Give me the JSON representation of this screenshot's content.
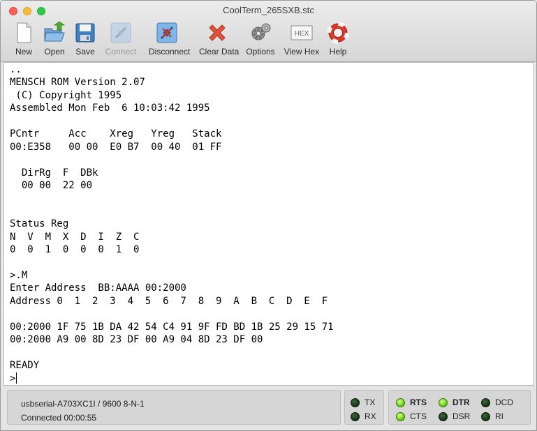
{
  "window": {
    "title": "CoolTerm_265SXB.stc"
  },
  "toolbar": {
    "buttons": [
      {
        "label": "New",
        "icon": "new-document-icon",
        "enabled": true
      },
      {
        "label": "Open",
        "icon": "open-folder-icon",
        "enabled": true
      },
      {
        "label": "Save",
        "icon": "floppy-disk-icon",
        "enabled": true
      },
      {
        "label": "Connect",
        "icon": "connect-plug-icon",
        "enabled": false
      },
      {
        "label": "Disconnect",
        "icon": "disconnect-plug-icon",
        "enabled": true
      },
      {
        "label": "Clear Data",
        "icon": "clear-x-icon",
        "enabled": true
      },
      {
        "label": "Options",
        "icon": "gears-icon",
        "enabled": true
      },
      {
        "label": "View Hex",
        "icon": "hex-icon",
        "enabled": true
      },
      {
        "label": "Help",
        "icon": "lifebuoy-icon",
        "enabled": true
      }
    ],
    "hex_icon_text": "HEX"
  },
  "terminal": {
    "lines": [
      "..",
      "MENSCH ROM Version 2.07",
      " (C) Copyright 1995",
      "Assembled Mon Feb  6 10:03:42 1995",
      "",
      "PCntr     Acc    Xreg   Yreg   Stack",
      "00:E358   00 00  E0 B7  00 40  01 FF",
      "",
      "  DirRg  F  DBk",
      "  00 00  22 00",
      "",
      "",
      "Status Reg",
      "N  V  M  X  D  I  Z  C",
      "0  0  1  0  0  0  1  0",
      "",
      ">.M",
      "Enter Address  BB:AAAA 00:2000",
      "Address 0  1  2  3  4  5  6  7  8  9  A  B  C  D  E  F",
      "",
      "00:2000 1F 75 1B DA 42 54 C4 91 9F FD BD 1B 25 29 15 71",
      "00:2000 A9 00 8D 23 DF 00 A9 04 8D 23 DF 00",
      "",
      "READY"
    ],
    "prompt": ">"
  },
  "status": {
    "port_settings": "usbserial-A703XC1I / 9600 8-N-1",
    "connection": "Connected 00:00:55",
    "leds": {
      "tx": {
        "label": "TX",
        "on": false
      },
      "rx": {
        "label": "RX",
        "on": false
      },
      "rts": {
        "label": "RTS",
        "on": true
      },
      "cts": {
        "label": "CTS",
        "on": true
      },
      "dtr": {
        "label": "DTR",
        "on": true
      },
      "dsr": {
        "label": "DSR",
        "on": false
      },
      "dcd": {
        "label": "DCD",
        "on": false
      },
      "ri": {
        "label": "RI",
        "on": false
      }
    }
  },
  "colors": {
    "led_on": "#6ccb1a",
    "led_off": "#1d3a1d",
    "terminal_bg": "#ffffff"
  }
}
